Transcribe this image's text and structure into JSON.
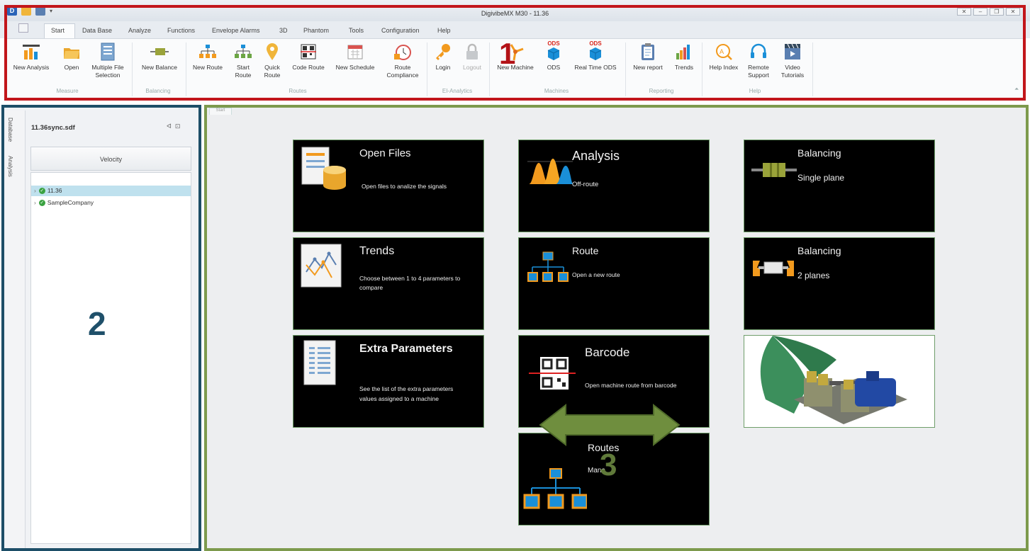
{
  "window": {
    "title": "DigivibeMX M30 - 11.36",
    "controls": [
      "✕",
      "–",
      "❐",
      "✕"
    ]
  },
  "tabs": [
    "Start",
    "Data Base",
    "Analyze",
    "Functions",
    "Envelope Alarms",
    "3D",
    "Phantom",
    "Tools",
    "Configuration",
    "Help"
  ],
  "ribbon": {
    "measure": {
      "group": "Measure",
      "new_analysis": "New Analysis",
      "open": "Open",
      "multiple_file_1": "Multiple File",
      "multiple_file_2": "Selection"
    },
    "balancing": {
      "group": "Balancing",
      "new_balance": "New Balance"
    },
    "routes": {
      "group": "Routes",
      "new_route": "New Route",
      "start_route_1": "Start",
      "start_route_2": "Route",
      "quick_route_1": "Quick",
      "quick_route_2": "Route",
      "code_route": "Code Route",
      "new_schedule": "New Schedule",
      "route_compliance_1": "Route",
      "route_compliance_2": "Compliance"
    },
    "ei_analytics": {
      "group": "EI-Analytics",
      "login": "Login",
      "logout": "Logout"
    },
    "machines": {
      "group": "Machines",
      "new_machine": "New Machine",
      "ods": "ODS",
      "real_time_ods": "Real Time ODS",
      "ods_badge": "ODS"
    },
    "reporting": {
      "group": "Reporting",
      "new_report": "New report",
      "trends": "Trends"
    },
    "help": {
      "group": "Help",
      "help_index": "Help Index",
      "remote_1": "Remote",
      "remote_2": "Support",
      "video_1": "Video",
      "video_2": "Tutorials"
    }
  },
  "annotations": {
    "one": "1",
    "two": "2",
    "three": "3"
  },
  "left_panel": {
    "vertical_tabs": [
      "Database",
      "Analysis"
    ],
    "db_name": "11.36sync.sdf",
    "velocity_label": "Velocity",
    "tree": [
      "11.36",
      "SampleCompany"
    ]
  },
  "doc_tab": "Start",
  "tiles": {
    "open_files": {
      "title": "Open Files",
      "desc": "Open files to analize the signals"
    },
    "analysis": {
      "title": "Analysis",
      "desc": "Off-route"
    },
    "balancing1": {
      "title": "Balancing",
      "desc": "Single plane"
    },
    "trends": {
      "title": "Trends",
      "desc1": "Choose between 1 to 4 parameters to",
      "desc2": "compare"
    },
    "route": {
      "title": "Route",
      "desc": "Open a new route"
    },
    "balancing2": {
      "title": "Balancing",
      "desc": "2 planes"
    },
    "extra": {
      "title": "Extra Parameters",
      "desc1": "See the list of the extra parameters",
      "desc2": "values assigned to a machine"
    },
    "barcode": {
      "title": "Barcode",
      "desc": "Open machine route from barcode"
    },
    "routes": {
      "title": "Routes",
      "desc": "Mana"
    }
  },
  "colors": {
    "red_frame": "#c2161b",
    "blue_frame": "#1d4e67",
    "green_frame": "#7d9a4d",
    "tile_bg": "#000000",
    "orange": "#f29a1e",
    "blue_icon": "#1a8fd8"
  }
}
